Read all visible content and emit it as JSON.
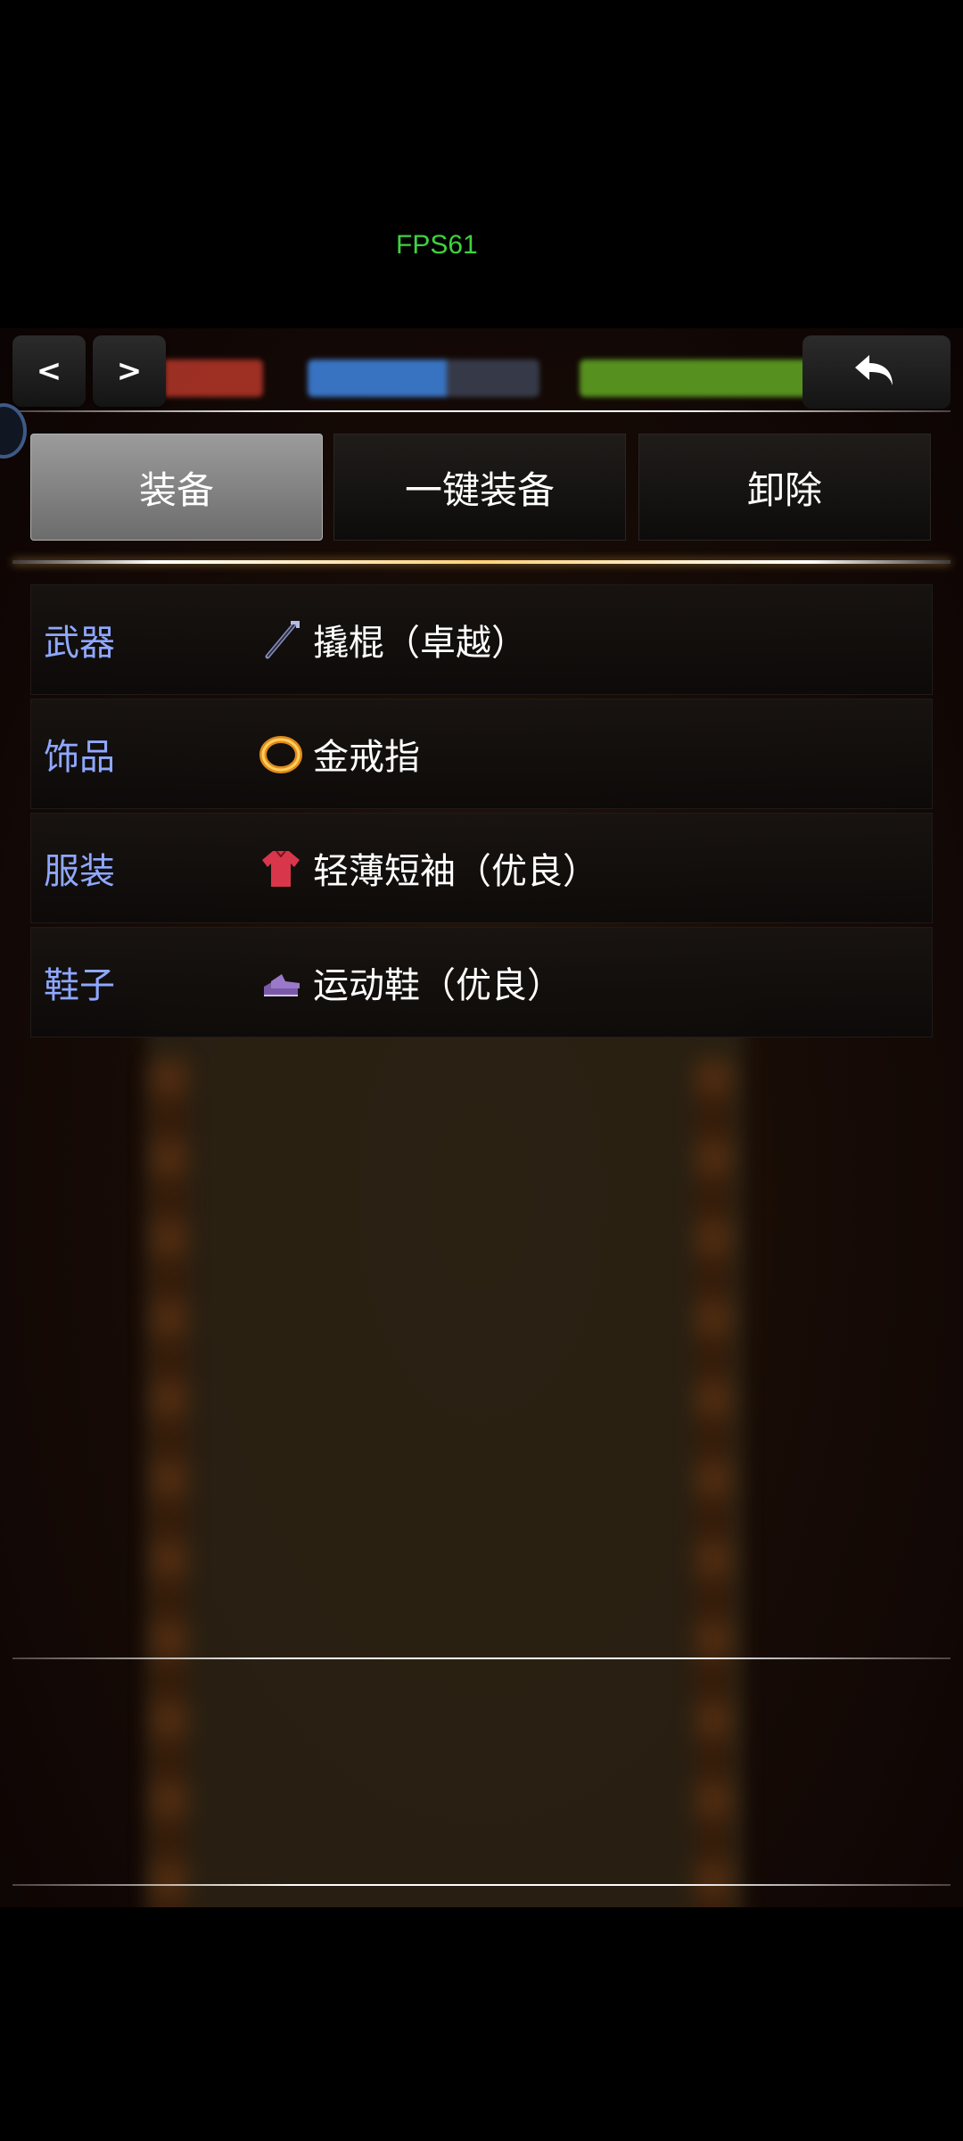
{
  "fps": "FPS61",
  "nav": {
    "prev_label": "<",
    "next_label": ">"
  },
  "tabs": [
    {
      "label": "装备",
      "active": true
    },
    {
      "label": "一键装备",
      "active": false
    },
    {
      "label": "卸除",
      "active": false
    }
  ],
  "slots": [
    {
      "category": "武器",
      "item": "撬棍（卓越）",
      "icon": "crowbar-icon"
    },
    {
      "category": "饰品",
      "item": "金戒指",
      "icon": "gold-ring-icon"
    },
    {
      "category": "服装",
      "item": "轻薄短袖（优良）",
      "icon": "red-shirt-icon"
    },
    {
      "category": "鞋子",
      "item": "运动鞋（优良）",
      "icon": "sneakers-icon"
    }
  ],
  "colors": {
    "category_text": "#8fa8ff",
    "fps_text": "#3fd23f",
    "active_tab": "#8a8a8a"
  }
}
